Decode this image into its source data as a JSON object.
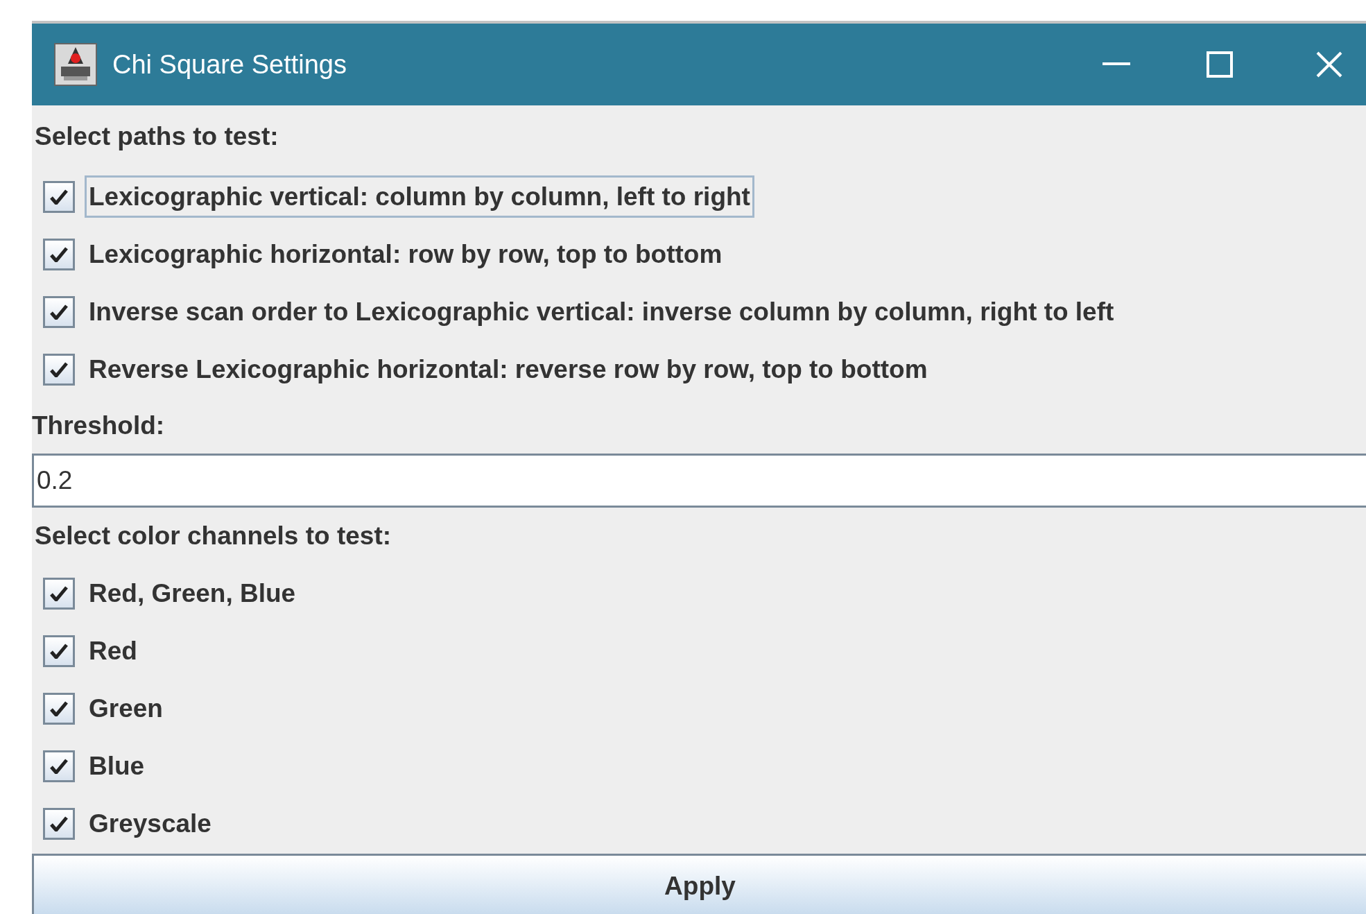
{
  "window": {
    "title": "Chi Square Settings"
  },
  "paths": {
    "label": "Select paths to test:",
    "options": [
      {
        "label": "Lexicographic vertical: column by column, left to right",
        "checked": true,
        "focused": true
      },
      {
        "label": "Lexicographic horizontal: row by row, top to bottom",
        "checked": true,
        "focused": false
      },
      {
        "label": "Inverse scan order to Lexicographic vertical: inverse column by column, right to left",
        "checked": true,
        "focused": false
      },
      {
        "label": "Reverse Lexicographic horizontal: reverse row by row, top to bottom",
        "checked": true,
        "focused": false
      }
    ]
  },
  "threshold": {
    "label": "Threshold:",
    "value": "0.2"
  },
  "channels": {
    "label": "Select color channels to test:",
    "options": [
      {
        "label": "Red, Green, Blue",
        "checked": true,
        "focused": false
      },
      {
        "label": "Red",
        "checked": true,
        "focused": false
      },
      {
        "label": "Green",
        "checked": true,
        "focused": false
      },
      {
        "label": "Blue",
        "checked": true,
        "focused": false
      },
      {
        "label": "Greyscale",
        "checked": true,
        "focused": false
      }
    ]
  },
  "apply_button": {
    "label": "Apply"
  }
}
